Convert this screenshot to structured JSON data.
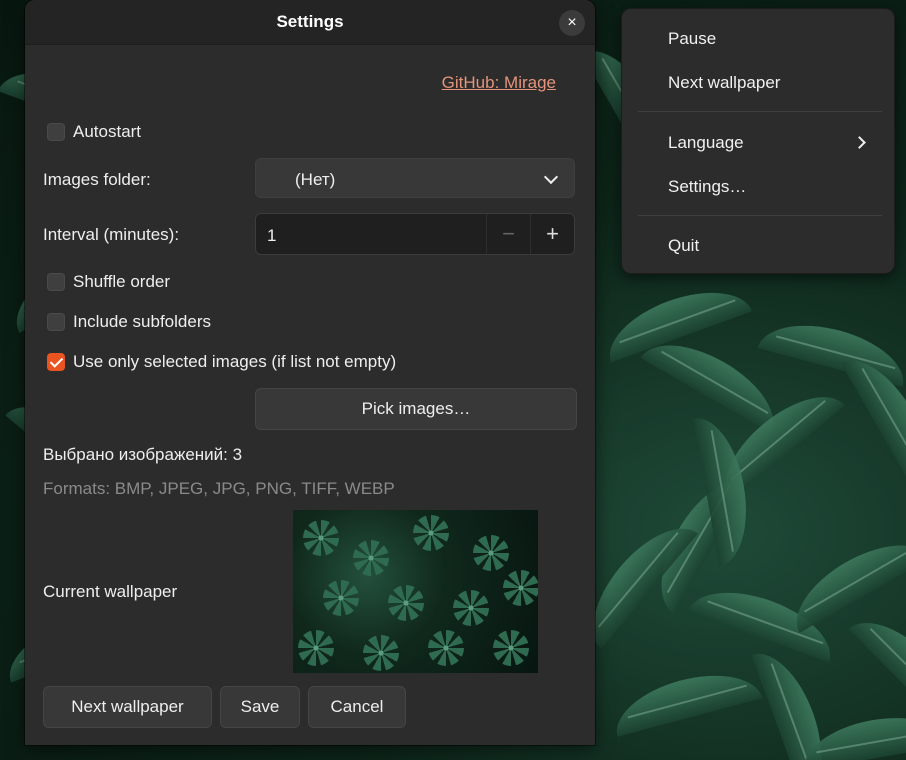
{
  "dialog": {
    "title": "Settings",
    "close_glyph": "×",
    "github_link": "GitHub: Mirage",
    "autostart_label": "Autostart",
    "autostart_checked": false,
    "images_folder_label": "Images folder:",
    "images_folder_value": "(Нет)",
    "interval_label": "Interval (minutes):",
    "interval_value": "1",
    "decrement_glyph": "−",
    "increment_glyph": "+",
    "shuffle_label": "Shuffle order",
    "shuffle_checked": false,
    "subfolders_label": "Include subfolders",
    "subfolders_checked": false,
    "selected_only_label": "Use only selected images (if list not empty)",
    "selected_only_checked": true,
    "pick_images_label": "Pick images…",
    "selected_count_text": "Выбрано изображений: 3",
    "formats_text": "Formats: BMP, JPEG, JPG, PNG, TIFF, WEBP",
    "current_wallpaper_label": "Current wallpaper",
    "next_wallpaper_button": "Next wallpaper",
    "save_button": "Save",
    "cancel_button": "Cancel"
  },
  "menu": {
    "items": [
      "Pause",
      "Next wallpaper",
      "Language",
      "Settings…",
      "Quit"
    ]
  },
  "colors": {
    "accent": "#e95420",
    "link": "#e3947a",
    "dialog_bg": "#2c2c2c"
  }
}
